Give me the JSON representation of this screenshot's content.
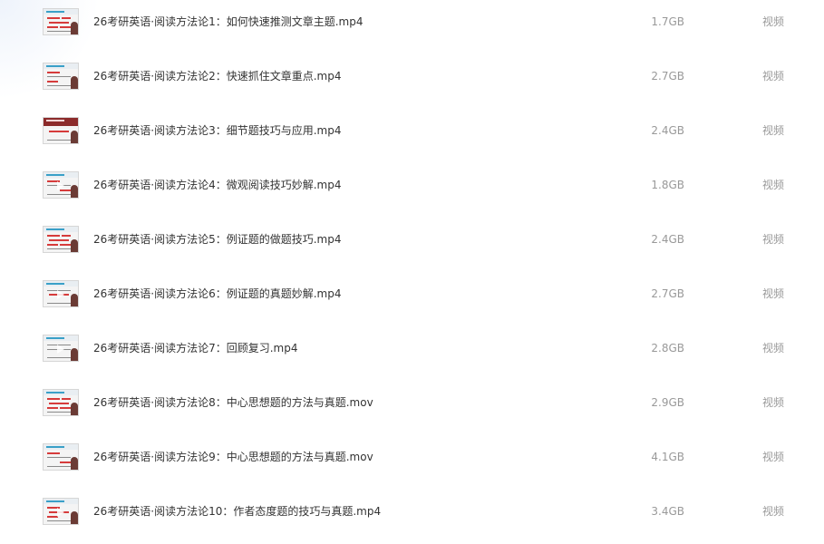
{
  "files": [
    {
      "name": "26考研英语·阅读方法论1：如何快速推测文章主题.mp4",
      "size": "1.7GB",
      "type": "视频",
      "thumbnail": "video-thumbnail-icon"
    },
    {
      "name": "26考研英语·阅读方法论2：快速抓住文章重点.mp4",
      "size": "2.7GB",
      "type": "视频",
      "thumbnail": "video-thumbnail-icon"
    },
    {
      "name": "26考研英语·阅读方法论3：细节题技巧与应用.mp4",
      "size": "2.4GB",
      "type": "视频",
      "thumbnail": "video-thumbnail-icon"
    },
    {
      "name": "26考研英语·阅读方法论4：微观阅读技巧妙解.mp4",
      "size": "1.8GB",
      "type": "视频",
      "thumbnail": "video-thumbnail-icon"
    },
    {
      "name": "26考研英语·阅读方法论5：例证题的做题技巧.mp4",
      "size": "2.4GB",
      "type": "视频",
      "thumbnail": "video-thumbnail-icon"
    },
    {
      "name": "26考研英语·阅读方法论6：例证题的真题妙解.mp4",
      "size": "2.7GB",
      "type": "视频",
      "thumbnail": "video-thumbnail-icon"
    },
    {
      "name": "26考研英语·阅读方法论7：回顾复习.mp4",
      "size": "2.8GB",
      "type": "视频",
      "thumbnail": "video-thumbnail-icon"
    },
    {
      "name": "26考研英语·阅读方法论8：中心思想题的方法与真题.mov",
      "size": "2.9GB",
      "type": "视频",
      "thumbnail": "video-thumbnail-icon"
    },
    {
      "name": "26考研英语·阅读方法论9：中心思想题的方法与真题.mov",
      "size": "4.1GB",
      "type": "视频",
      "thumbnail": "video-thumbnail-icon"
    },
    {
      "name": "26考研英语·阅读方法论10：作者态度题的技巧与真题.mp4",
      "size": "3.4GB",
      "type": "视频",
      "thumbnail": "video-thumbnail-icon"
    }
  ]
}
